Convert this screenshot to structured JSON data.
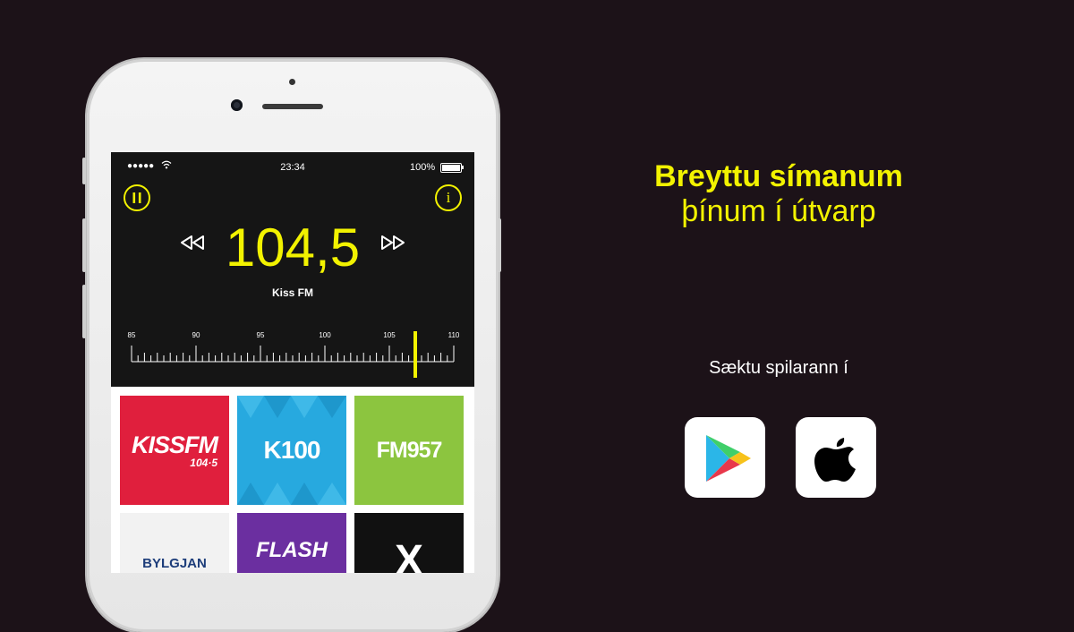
{
  "status_bar": {
    "signal": "●●●●●",
    "wifi_icon": "wifi-icon",
    "time": "23:34",
    "battery": "100%"
  },
  "player": {
    "pause_icon": "pause-icon",
    "info_icon": "info-icon",
    "info_glyph": "i",
    "pause_glyph": "⏸",
    "frequency": "104,5",
    "skip_back_glyph": "◁◁",
    "skip_forward_glyph": "▷▷",
    "station_name": "Kiss FM"
  },
  "dial": {
    "labels": [
      "85",
      "90",
      "95",
      "100",
      "105",
      "110"
    ],
    "min": 85,
    "max": 110,
    "current": 107
  },
  "stations": [
    {
      "label": "KISSFM",
      "sub": "104·5",
      "color": "#e01f3d"
    },
    {
      "label": "K100",
      "sub": "",
      "color": "#27a9df"
    },
    {
      "label": "FM957",
      "sub": "",
      "color": "#8cc53f"
    },
    {
      "label": "BYLGJAN",
      "sub": "",
      "color": "#f2f2f2"
    },
    {
      "label": "FLASH",
      "sub": "",
      "color": "#6b2fa0"
    },
    {
      "label": "X",
      "sub": "",
      "color": "#111111"
    }
  ],
  "promo": {
    "headline_bold": "Breyttu símanum",
    "headline_regular": "þínum í útvarp",
    "download_text": "Sæktu spilarann í",
    "google_play_icon": "google-play-icon",
    "apple_icon": "apple-icon"
  },
  "colors": {
    "accent": "#f2f200",
    "background": "#1c1218"
  }
}
